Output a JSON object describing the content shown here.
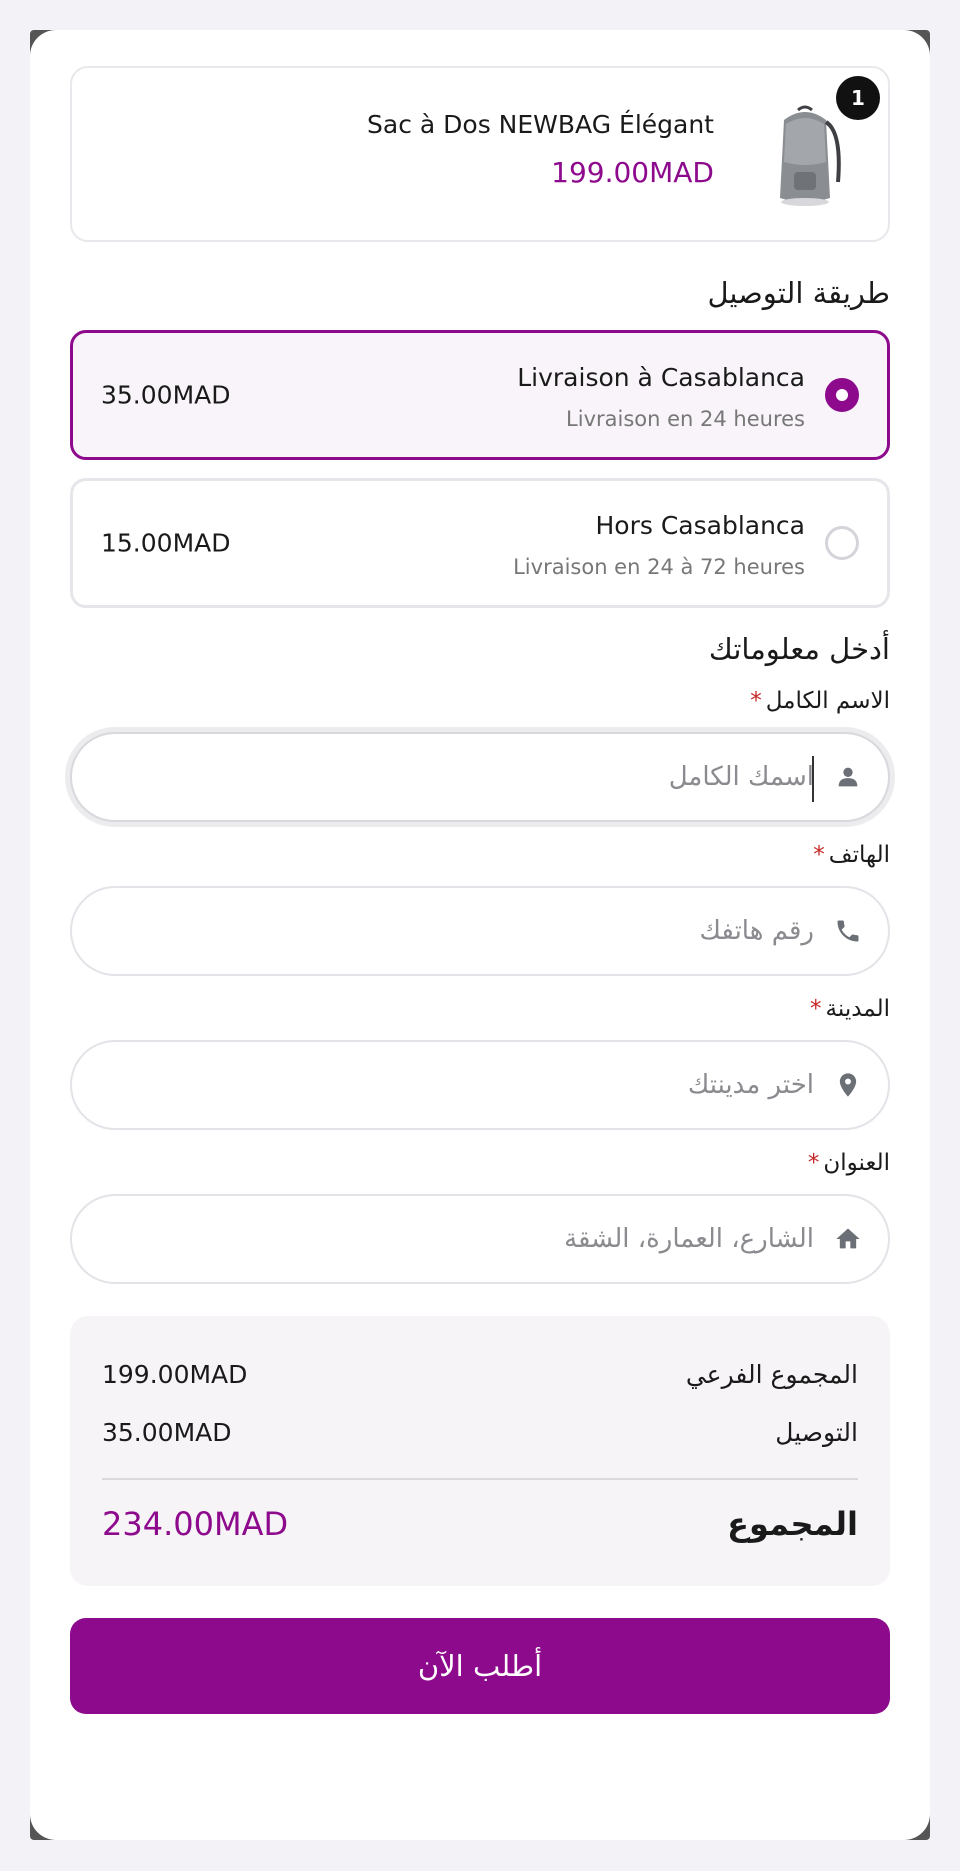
{
  "product": {
    "name": "Sac à Dos NEWBAG Élégant",
    "price": "199.00MAD",
    "quantity": "1",
    "image_icon": "backpack-image"
  },
  "shipping": {
    "title": "طريقة التوصيل",
    "options": [
      {
        "name": "Livraison à Casablanca",
        "description": "Livraison en 24 heures",
        "price": "35.00MAD",
        "selected": true
      },
      {
        "name": "Hors Casablanca",
        "description": "Livraison en 24 à 72 heures",
        "price": "15.00MAD",
        "selected": false
      }
    ]
  },
  "form": {
    "title": "أدخل معلوماتك",
    "required_mark": "*",
    "fields": [
      {
        "label": "الاسم الكامل",
        "placeholder": "اسمك الكامل",
        "value": "",
        "icon": "user-icon"
      },
      {
        "label": "الهاتف",
        "placeholder": "رقم هاتفك",
        "value": "",
        "icon": "phone-icon"
      },
      {
        "label": "المدينة",
        "placeholder": "اختر مدينتك",
        "value": "",
        "icon": "location-pin-icon"
      },
      {
        "label": "العنوان",
        "placeholder": "الشارع، العمارة، الشقة",
        "value": "",
        "icon": "home-icon"
      }
    ]
  },
  "summary": {
    "subtotal_label": "المجموع الفرعي",
    "subtotal_value": "199.00MAD",
    "shipping_label": "التوصيل",
    "shipping_value": "35.00MAD",
    "total_label": "المجموع",
    "total_value": "234.00MAD"
  },
  "actions": {
    "order_label": "أطلب الآن"
  },
  "colors": {
    "accent": "#8d0a8d",
    "required": "#c62828"
  }
}
